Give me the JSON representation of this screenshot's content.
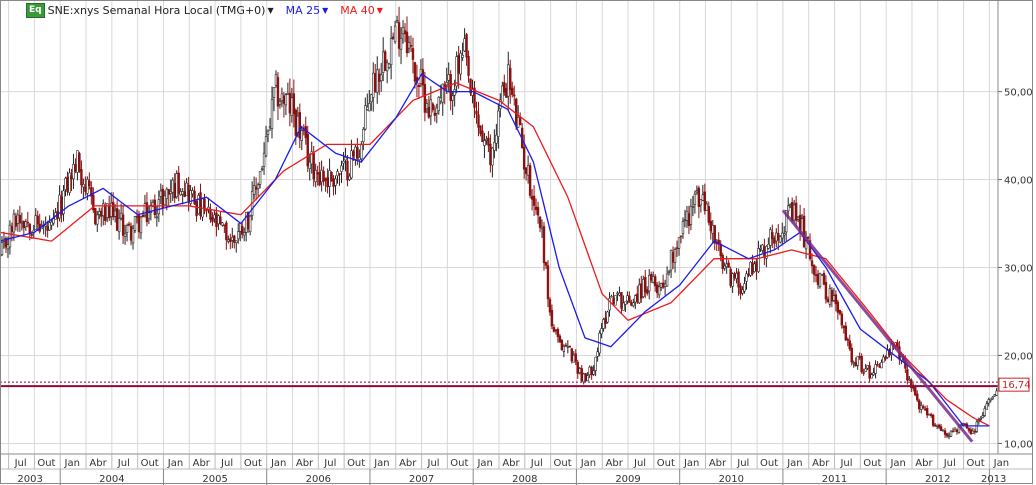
{
  "legend": {
    "badge": "Eq",
    "symbol": "SNE:xnys Semanal Hora Local (TMG+0)",
    "ma1_label": "MA 25",
    "ma2_label": "MA 40",
    "ma1_color": "#1a1aee",
    "ma2_color": "#ee1a1a"
  },
  "colors": {
    "up_bar": "#222222",
    "down_bar": "#8b1010",
    "price_line": "#8b0a3a",
    "trendline": "#7a2a8a",
    "grid": "#d8d8d8",
    "price_tag": "#cc2222"
  },
  "chart_data": {
    "type": "candlestick",
    "ylim": [
      8.8,
      60.3
    ],
    "y_ticks": [
      "10,00",
      "20,00",
      "30,00",
      "40,00",
      "50,00"
    ],
    "y_tick_values": [
      10,
      20,
      30,
      40,
      50
    ],
    "x_start": "2003-06",
    "x_end": "2013-02",
    "months": [
      "Jul",
      "Out",
      "Jan",
      "Abr",
      "Jul",
      "Out",
      "Jan",
      "Abr",
      "Jul",
      "Out",
      "Jan",
      "Abr",
      "Jul",
      "Out",
      "Jan",
      "Abr",
      "Jul",
      "Out",
      "Jan",
      "Abr",
      "Jul",
      "Out",
      "Jan",
      "Abr",
      "Jul",
      "Out",
      "Jan",
      "Abr",
      "Jul",
      "Out",
      "Jan",
      "Abr",
      "Jul",
      "Out",
      "Jan",
      "Abr",
      "Jul",
      "Out",
      "Jan"
    ],
    "month_dates": [
      "2003-07",
      "2003-10",
      "2004-01",
      "2004-04",
      "2004-07",
      "2004-10",
      "2005-01",
      "2005-04",
      "2005-07",
      "2005-10",
      "2006-01",
      "2006-04",
      "2006-07",
      "2006-10",
      "2007-01",
      "2007-04",
      "2007-07",
      "2007-10",
      "2008-01",
      "2008-04",
      "2008-07",
      "2008-10",
      "2009-01",
      "2009-04",
      "2009-07",
      "2009-10",
      "2010-01",
      "2010-04",
      "2010-07",
      "2010-10",
      "2011-01",
      "2011-04",
      "2011-07",
      "2011-10",
      "2012-01",
      "2012-04",
      "2012-07",
      "2012-10",
      "2013-01"
    ],
    "years": [
      "2003",
      "2004",
      "2005",
      "2006",
      "2007",
      "2008",
      "2009",
      "2010",
      "2011",
      "2012",
      "2013"
    ],
    "year_dates": [
      "2003-06",
      "2004-01",
      "2005-01",
      "2006-01",
      "2007-01",
      "2008-01",
      "2009-01",
      "2010-01",
      "2011-01",
      "2012-01",
      "2013-01"
    ],
    "last_price": "16,74",
    "last_price_value": 16.74,
    "horizontal_line": 16.74,
    "trendline": {
      "start": [
        "2011-01",
        36.5
      ],
      "end": [
        "2012-11",
        10.2
      ]
    },
    "price_path": [
      [
        "2003-06",
        31
      ],
      [
        "2003-08",
        36
      ],
      [
        "2003-10",
        35
      ],
      [
        "2003-12",
        34
      ],
      [
        "2004-02",
        40
      ],
      [
        "2004-03",
        42
      ],
      [
        "2004-05",
        36
      ],
      [
        "2004-07",
        36
      ],
      [
        "2004-09",
        34
      ],
      [
        "2004-11",
        36
      ],
      [
        "2005-01",
        38
      ],
      [
        "2005-03",
        40
      ],
      [
        "2005-05",
        37
      ],
      [
        "2005-07",
        35
      ],
      [
        "2005-09",
        33
      ],
      [
        "2005-11",
        36
      ],
      [
        "2006-01",
        44
      ],
      [
        "2006-02",
        50
      ],
      [
        "2006-04",
        48
      ],
      [
        "2006-06",
        42
      ],
      [
        "2006-08",
        40
      ],
      [
        "2006-10",
        41
      ],
      [
        "2006-12",
        44
      ],
      [
        "2007-01",
        50
      ],
      [
        "2007-03",
        55
      ],
      [
        "2007-05",
        58
      ],
      [
        "2007-06",
        53
      ],
      [
        "2007-08",
        48
      ],
      [
        "2007-10",
        50
      ],
      [
        "2007-12",
        54
      ],
      [
        "2008-01",
        48
      ],
      [
        "2008-03",
        42
      ],
      [
        "2008-04",
        48
      ],
      [
        "2008-05",
        52
      ],
      [
        "2008-07",
        42
      ],
      [
        "2008-09",
        34
      ],
      [
        "2008-10",
        24
      ],
      [
        "2008-11",
        21
      ],
      [
        "2008-12",
        21
      ],
      [
        "2009-01",
        19
      ],
      [
        "2009-02",
        17
      ],
      [
        "2009-03",
        19
      ],
      [
        "2009-05",
        27
      ],
      [
        "2009-07",
        26
      ],
      [
        "2009-09",
        28
      ],
      [
        "2009-11",
        28
      ],
      [
        "2010-01",
        34
      ],
      [
        "2010-03",
        38
      ],
      [
        "2010-04",
        37
      ],
      [
        "2010-06",
        30
      ],
      [
        "2010-08",
        28
      ],
      [
        "2010-10",
        31
      ],
      [
        "2010-12",
        34
      ],
      [
        "2011-02",
        36
      ],
      [
        "2011-03",
        35
      ],
      [
        "2011-05",
        29
      ],
      [
        "2011-07",
        26
      ],
      [
        "2011-09",
        20
      ],
      [
        "2011-11",
        18
      ],
      [
        "2012-01",
        20
      ],
      [
        "2012-02",
        21
      ],
      [
        "2012-03",
        19
      ],
      [
        "2012-05",
        14
      ],
      [
        "2012-07",
        12
      ],
      [
        "2012-08",
        11
      ],
      [
        "2012-10",
        12
      ],
      [
        "2012-11",
        11
      ],
      [
        "2012-12",
        13
      ],
      [
        "2013-01",
        15
      ],
      [
        "2013-02",
        16.74
      ]
    ],
    "ma25_path": [
      [
        "2003-06",
        33
      ],
      [
        "2003-10",
        34
      ],
      [
        "2004-02",
        37
      ],
      [
        "2004-06",
        39
      ],
      [
        "2004-10",
        36
      ],
      [
        "2005-02",
        37
      ],
      [
        "2005-06",
        38
      ],
      [
        "2005-10",
        35
      ],
      [
        "2006-02",
        40
      ],
      [
        "2006-05",
        46
      ],
      [
        "2006-09",
        43
      ],
      [
        "2006-12",
        42
      ],
      [
        "2007-04",
        47
      ],
      [
        "2007-07",
        52
      ],
      [
        "2007-10",
        50
      ],
      [
        "2008-01",
        50
      ],
      [
        "2008-05",
        48
      ],
      [
        "2008-08",
        42
      ],
      [
        "2008-11",
        30
      ],
      [
        "2009-02",
        22
      ],
      [
        "2009-05",
        21
      ],
      [
        "2009-09",
        25
      ],
      [
        "2010-01",
        28
      ],
      [
        "2010-05",
        33
      ],
      [
        "2010-09",
        31
      ],
      [
        "2010-12",
        32
      ],
      [
        "2011-03",
        34
      ],
      [
        "2011-06",
        30
      ],
      [
        "2011-10",
        23
      ],
      [
        "2012-02",
        20
      ],
      [
        "2012-06",
        17
      ],
      [
        "2012-10",
        12
      ],
      [
        "2013-01",
        12
      ]
    ],
    "ma40_path": [
      [
        "2003-06",
        34
      ],
      [
        "2003-12",
        33
      ],
      [
        "2004-05",
        37
      ],
      [
        "2004-10",
        37
      ],
      [
        "2005-04",
        37
      ],
      [
        "2005-10",
        36
      ],
      [
        "2006-03",
        41
      ],
      [
        "2006-08",
        44
      ],
      [
        "2007-01",
        44
      ],
      [
        "2007-06",
        49
      ],
      [
        "2007-11",
        51
      ],
      [
        "2008-04",
        49
      ],
      [
        "2008-08",
        46
      ],
      [
        "2008-12",
        38
      ],
      [
        "2009-04",
        27
      ],
      [
        "2009-07",
        24
      ],
      [
        "2009-12",
        26
      ],
      [
        "2010-05",
        31
      ],
      [
        "2010-10",
        31
      ],
      [
        "2011-02",
        32
      ],
      [
        "2011-06",
        31
      ],
      [
        "2011-11",
        25
      ],
      [
        "2012-03",
        20
      ],
      [
        "2012-08",
        15
      ],
      [
        "2012-11",
        13
      ],
      [
        "2013-01",
        12
      ]
    ]
  }
}
